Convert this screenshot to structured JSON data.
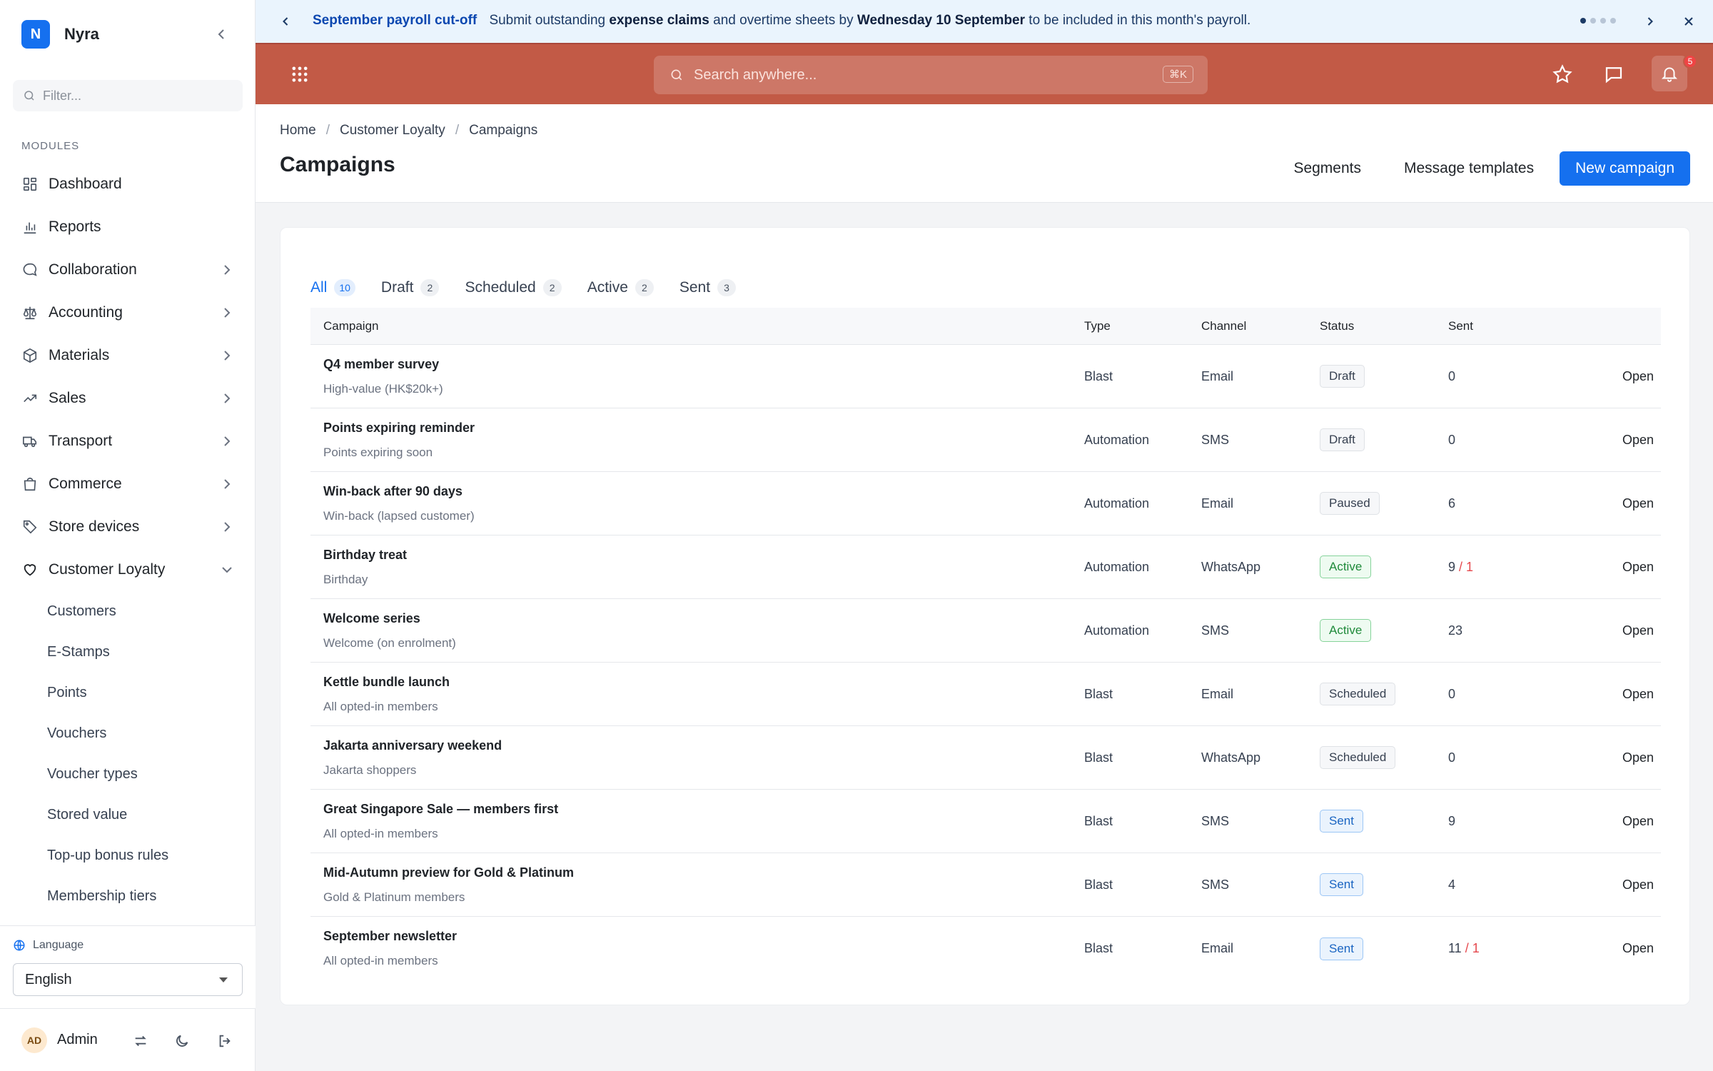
{
  "app": {
    "logo_letter": "N",
    "name": "Nyra"
  },
  "sidebar": {
    "filter_placeholder": "Filter...",
    "modules_label": "MODULES",
    "items": [
      {
        "label": "Dashboard",
        "icon": "dashboard-icon"
      },
      {
        "label": "Reports",
        "icon": "bar-chart-icon"
      },
      {
        "label": "Collaboration",
        "icon": "chat-bubble-icon"
      },
      {
        "label": "Accounting",
        "icon": "scales-icon"
      },
      {
        "label": "Materials",
        "icon": "box-icon"
      },
      {
        "label": "Sales",
        "icon": "trend-up-icon"
      },
      {
        "label": "Transport",
        "icon": "truck-icon"
      },
      {
        "label": "Commerce",
        "icon": "shopping-bag-icon"
      },
      {
        "label": "Store devices",
        "icon": "tag-icon"
      },
      {
        "label": "Customer Loyalty",
        "icon": "heart-icon"
      }
    ],
    "sub_items": [
      "Customers",
      "E-Stamps",
      "Points",
      "Vouchers",
      "Voucher types",
      "Stored value",
      "Top-up bonus rules",
      "Membership tiers"
    ],
    "language_label": "Language",
    "language_value": "English",
    "user": {
      "initials": "AD",
      "name": "Admin"
    }
  },
  "announcement": {
    "title": "September payroll cut-off",
    "text_1": "Submit outstanding ",
    "bold_1": "expense claims",
    "text_2": " and overtime sheets by ",
    "bold_2": "Wednesday 10 September",
    "text_3": " to be included in this month's payroll."
  },
  "topbar": {
    "search_placeholder": "Search anywhere...",
    "search_shortcut": "⌘K",
    "notification_count": "5"
  },
  "breadcrumb": [
    "Home",
    "Customer Loyalty",
    "Campaigns"
  ],
  "page": {
    "title": "Campaigns",
    "segments_label": "Segments",
    "templates_label": "Message templates",
    "new_label": "New campaign"
  },
  "tabs": [
    {
      "label": "All",
      "count": "10"
    },
    {
      "label": "Draft",
      "count": "2"
    },
    {
      "label": "Scheduled",
      "count": "2"
    },
    {
      "label": "Active",
      "count": "2"
    },
    {
      "label": "Sent",
      "count": "3"
    }
  ],
  "table": {
    "headers": {
      "campaign": "Campaign",
      "type": "Type",
      "channel": "Channel",
      "status": "Status",
      "sent": "Sent"
    },
    "open_label": "Open",
    "rows": [
      {
        "name": "Q4 member survey",
        "segment": "High-value (HK$20k+)",
        "type": "Blast",
        "channel": "Email",
        "status": "Draft",
        "sent": "0",
        "failed": ""
      },
      {
        "name": "Points expiring reminder",
        "segment": "Points expiring soon",
        "type": "Automation",
        "channel": "SMS",
        "status": "Draft",
        "sent": "0",
        "failed": ""
      },
      {
        "name": "Win-back after 90 days",
        "segment": "Win-back (lapsed customer)",
        "type": "Automation",
        "channel": "Email",
        "status": "Paused",
        "sent": "6",
        "failed": ""
      },
      {
        "name": "Birthday treat",
        "segment": "Birthday",
        "type": "Automation",
        "channel": "WhatsApp",
        "status": "Active",
        "sent": "9",
        "failed": "1"
      },
      {
        "name": "Welcome series",
        "segment": "Welcome (on enrolment)",
        "type": "Automation",
        "channel": "SMS",
        "status": "Active",
        "sent": "23",
        "failed": ""
      },
      {
        "name": "Kettle bundle launch",
        "segment": "All opted-in members",
        "type": "Blast",
        "channel": "Email",
        "status": "Scheduled",
        "sent": "0",
        "failed": ""
      },
      {
        "name": "Jakarta anniversary weekend",
        "segment": "Jakarta shoppers",
        "type": "Blast",
        "channel": "WhatsApp",
        "status": "Scheduled",
        "sent": "0",
        "failed": ""
      },
      {
        "name": "Great Singapore Sale — members first",
        "segment": "All opted-in members",
        "type": "Blast",
        "channel": "SMS",
        "status": "Sent",
        "sent": "9",
        "failed": ""
      },
      {
        "name": "Mid-Autumn preview for Gold & Platinum",
        "segment": "Gold & Platinum members",
        "type": "Blast",
        "channel": "SMS",
        "status": "Sent",
        "sent": "4",
        "failed": ""
      },
      {
        "name": "September newsletter",
        "segment": "All opted-in members",
        "type": "Blast",
        "channel": "Email",
        "status": "Sent",
        "sent": "11",
        "failed": "1"
      }
    ]
  },
  "colors": {
    "accent": "#1570ef",
    "topbar": "#c25a46",
    "banner": "#eaf4fd"
  }
}
